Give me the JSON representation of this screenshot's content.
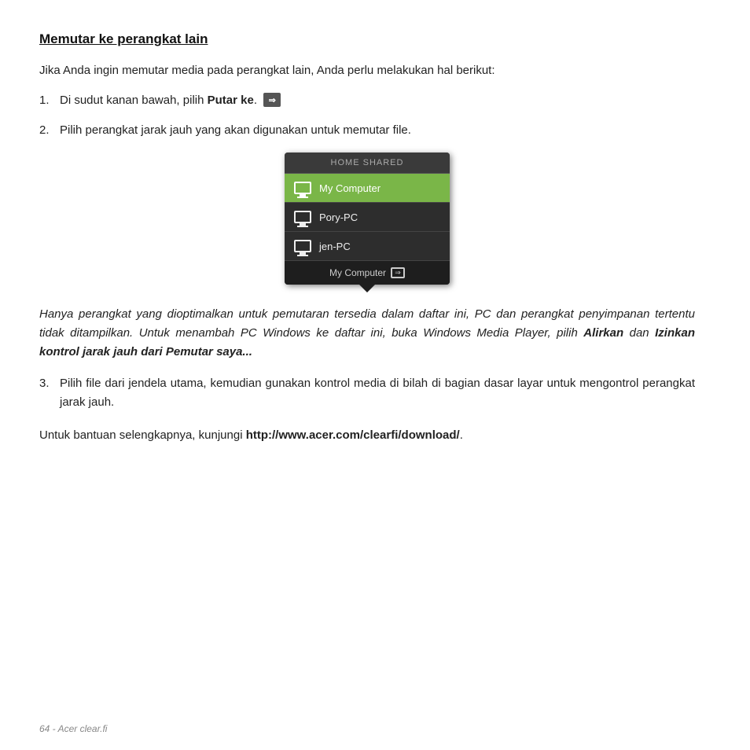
{
  "title": "Memutar ke perangkat lain",
  "intro": "Jika Anda ingin memutar media pada perangkat lain, Anda perlu melakukan hal berikut:",
  "steps": [
    {
      "num": "1.",
      "text_before": "Di sudut kanan bawah, pilih ",
      "bold": "Putar ke",
      "text_after": "."
    },
    {
      "num": "2.",
      "text": "Pilih perangkat jarak jauh yang akan digunakan untuk memutar file."
    },
    {
      "num": "3.",
      "text": "Pilih file dari jendela utama, kemudian gunakan kontrol media di bilah di bagian dasar layar untuk mengontrol perangkat jarak jauh."
    }
  ],
  "popup": {
    "header": "HOME SHARED",
    "items": [
      {
        "label": "My Computer",
        "active": true
      },
      {
        "label": "Pory-PC",
        "active": false
      },
      {
        "label": "jen-PC",
        "active": false
      }
    ],
    "footer": "My Computer"
  },
  "note": "Hanya perangkat yang dioptimalkan untuk pemutaran tersedia dalam daftar ini, PC dan perangkat penyimpanan tertentu tidak ditampilkan. Untuk menambah PC Windows ke daftar ini, buka Windows Media Player, pilih ",
  "note_bold1": "Alirkan",
  "note_mid": " dan ",
  "note_bold2": "Izinkan kontrol jarak jauh dari Pemutar saya...",
  "footer_text_before": "Untuk bantuan selengkapnya, kunjungi ",
  "footer_link": "http://www.acer.com/clearfi/download/",
  "footer_text_after": ".",
  "page_footer": "64 - Acer clear.fi"
}
